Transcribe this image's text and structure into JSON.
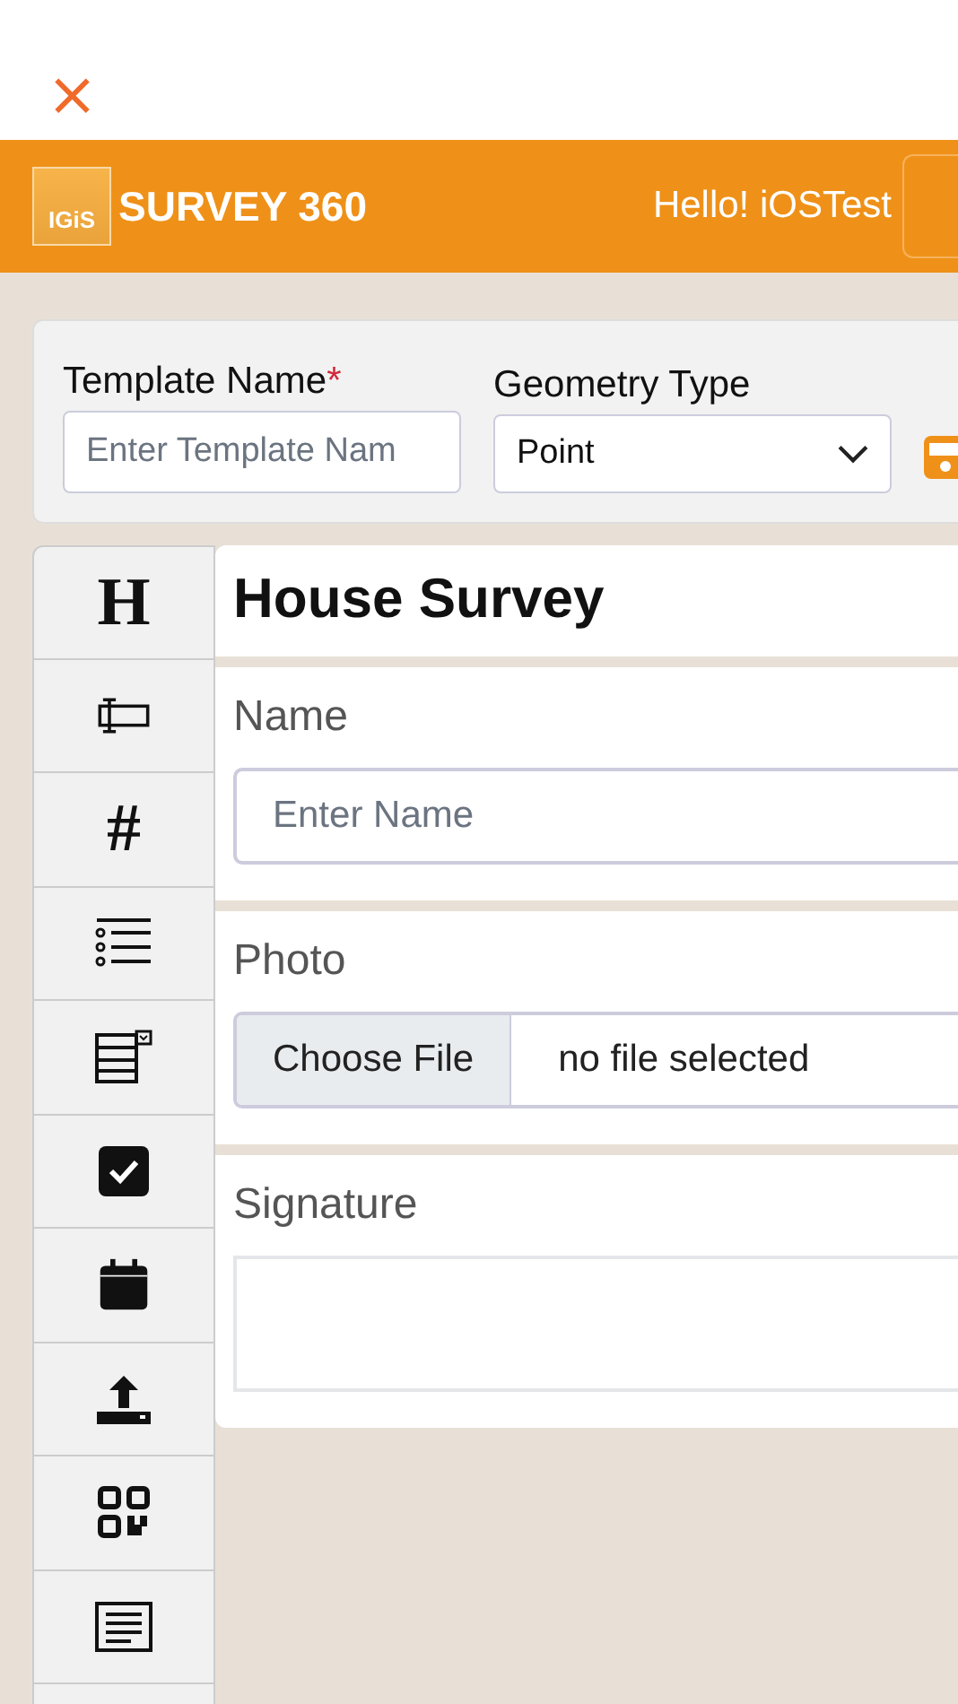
{
  "close_button": {
    "glyph": "×"
  },
  "header": {
    "logo_mark": "IGiS",
    "app_name": "SURVEY 360",
    "greeting": "Hello! iOSTest"
  },
  "template_panel": {
    "name_label": "Template Name",
    "required_mark": "*",
    "name_placeholder": "Enter Template Nam",
    "geometry_label": "Geometry Type",
    "geometry_value": "Point"
  },
  "toolbox": [
    {
      "kind": "glyph",
      "glyph": "H"
    },
    {
      "kind": "textbox"
    },
    {
      "kind": "glyph",
      "glyph": "#"
    },
    {
      "kind": "list"
    },
    {
      "kind": "dropdown"
    },
    {
      "kind": "checkbox"
    },
    {
      "kind": "calendar"
    },
    {
      "kind": "upload"
    },
    {
      "kind": "qr"
    },
    {
      "kind": "paragraph"
    },
    {
      "kind": "blank"
    }
  ],
  "form": [
    {
      "kind": "heading",
      "text": "House Survey"
    },
    {
      "kind": "text",
      "label": "Name",
      "placeholder": "Enter Name"
    },
    {
      "kind": "file",
      "label": "Photo",
      "button": "Choose File",
      "status": "no file selected"
    },
    {
      "kind": "signature",
      "label": "Signature"
    }
  ]
}
